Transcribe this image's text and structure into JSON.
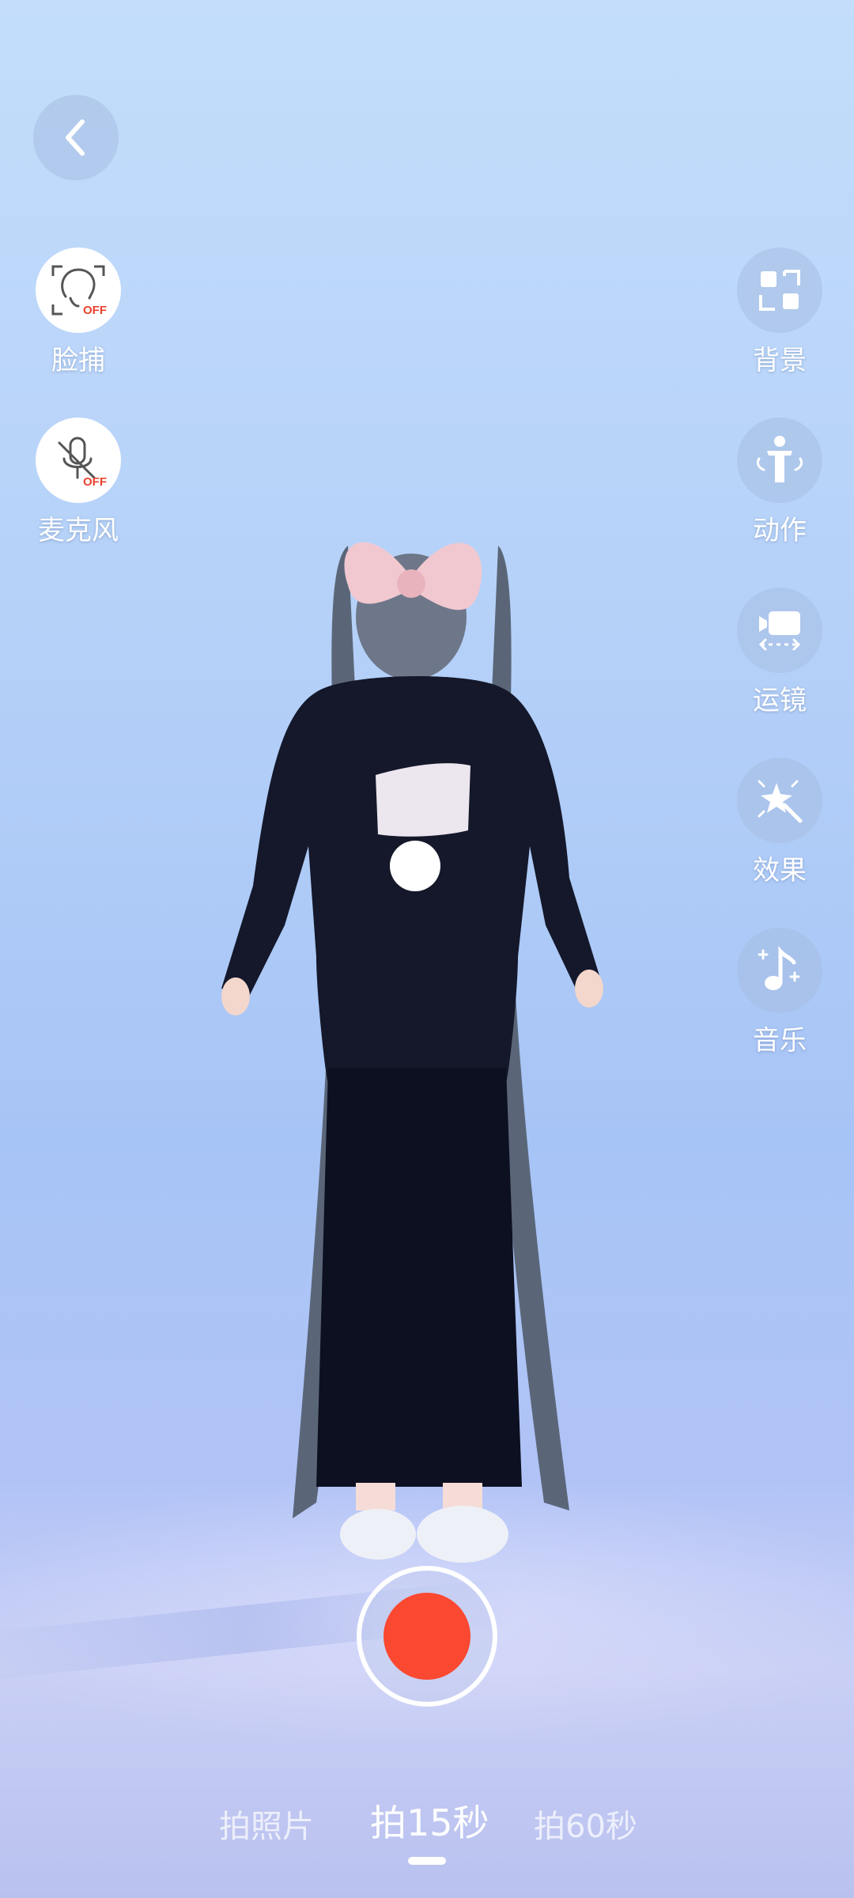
{
  "left_controls": [
    {
      "label": "脸捕",
      "icon": "face-capture-off-icon",
      "badge": "OFF"
    },
    {
      "label": "麦克风",
      "icon": "microphone-off-icon",
      "badge": "OFF"
    }
  ],
  "right_controls": [
    {
      "label": "背景",
      "icon": "background-grid-icon"
    },
    {
      "label": "动作",
      "icon": "motion-figure-icon"
    },
    {
      "label": "运镜",
      "icon": "camera-movement-icon"
    },
    {
      "label": "效果",
      "icon": "sparkle-wand-icon"
    },
    {
      "label": "音乐",
      "icon": "music-note-icon"
    }
  ],
  "modes": [
    {
      "label": "拍照片",
      "active": false
    },
    {
      "label": "拍15秒",
      "active": true
    },
    {
      "label": "拍60秒",
      "active": false
    }
  ],
  "colors": {
    "record": "#fa4831",
    "off_badge": "#e8412d"
  }
}
